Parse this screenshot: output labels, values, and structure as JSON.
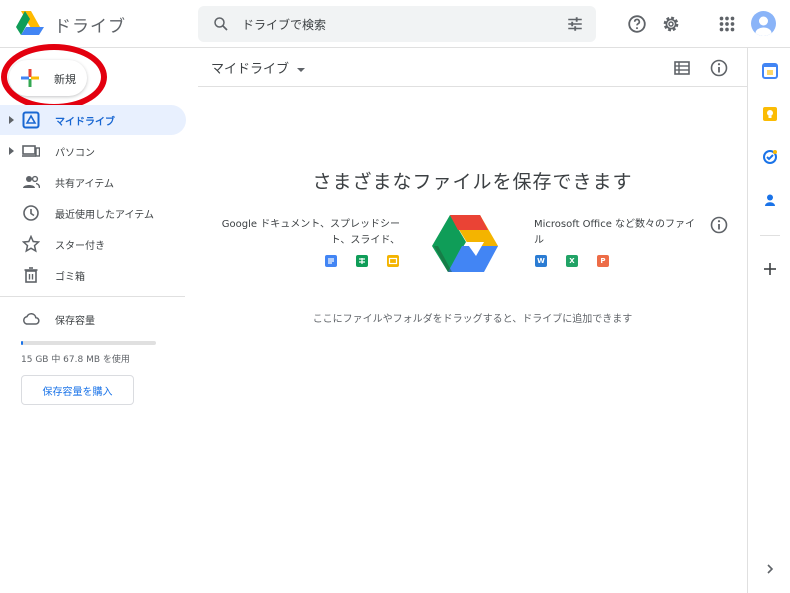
{
  "header": {
    "app_name": "ドライブ",
    "search_placeholder": "ドライブで検索"
  },
  "new_button": {
    "label": "新規"
  },
  "sidebar": {
    "items": [
      {
        "label": "マイドライブ",
        "icon": "my-drive-icon",
        "active": true,
        "expandable": true
      },
      {
        "label": "パソコン",
        "icon": "computers-icon",
        "active": false,
        "expandable": true
      },
      {
        "label": "共有アイテム",
        "icon": "shared-icon",
        "active": false,
        "expandable": false
      },
      {
        "label": "最近使用したアイテム",
        "icon": "clock-icon",
        "active": false,
        "expandable": false
      },
      {
        "label": "スター付き",
        "icon": "star-icon",
        "active": false,
        "expandable": false
      },
      {
        "label": "ゴミ箱",
        "icon": "trash-icon",
        "active": false,
        "expandable": false
      }
    ],
    "storage": {
      "label": "保存容量",
      "usage_text": "15 GB 中 67.8 MB を使用",
      "used_fraction": 0.0045,
      "buy_label": "保存容量を購入"
    }
  },
  "main": {
    "title": "マイドライブ",
    "empty_state": {
      "headline": "さまざまなファイルを保存できます",
      "left_text": "Google ドキュメント、スプレッドシート、スライド、",
      "right_text": "Microsoft Office など数々のファイル",
      "drop_hint": "ここにファイルやフォルダをドラッグすると、ドライブに追加できます",
      "office_letters": {
        "word": "W",
        "excel": "X",
        "powerpoint": "P"
      }
    }
  },
  "colors": {
    "accent_blue": "#1a73e8",
    "active_bg": "#e8f0fe",
    "annotation_red": "#e3000f",
    "docs_blue": "#4285f4",
    "sheets_green": "#0f9d58",
    "slides_yellow": "#f4b400",
    "word_blue": "#2b7cd3",
    "excel_green": "#21a366",
    "ppt_orange": "#ed6c47"
  }
}
